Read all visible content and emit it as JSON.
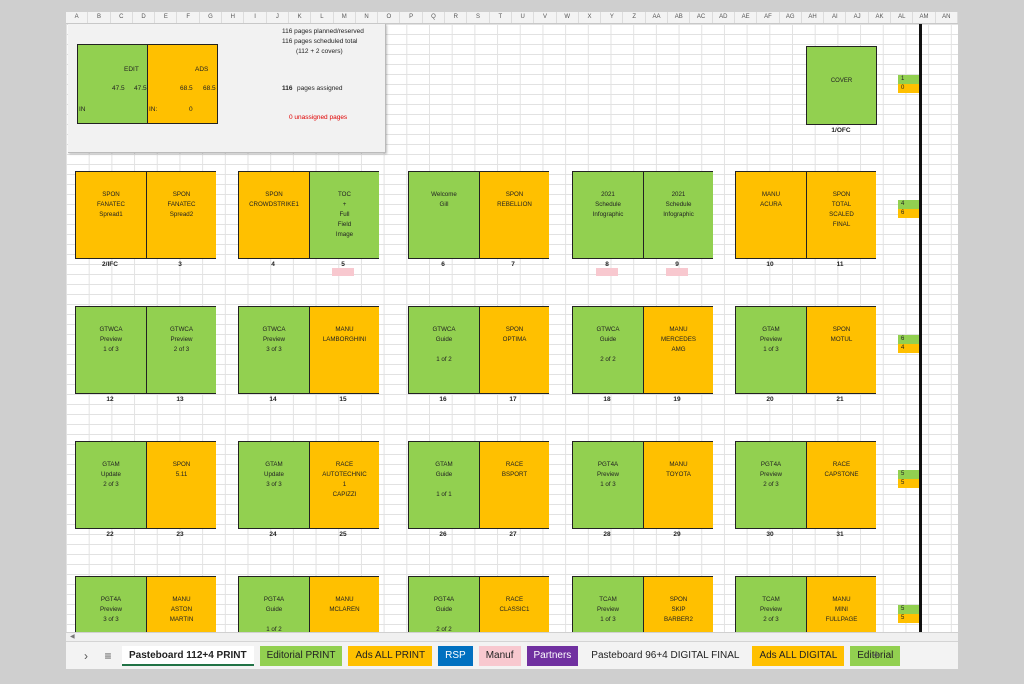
{
  "colors": {
    "editorial": "#92d050",
    "ads": "#ffc000",
    "pink": "#f8c8cf",
    "rsp": "#0070c0",
    "partners": "#7030a0"
  },
  "columns": [
    "A",
    "B",
    "C",
    "D",
    "E",
    "F",
    "G",
    "H",
    "I",
    "J",
    "K",
    "L",
    "M",
    "N",
    "O",
    "P",
    "Q",
    "R",
    "S",
    "T",
    "U",
    "V",
    "W",
    "X",
    "Y",
    "Z",
    "AA",
    "AB",
    "AC",
    "AD",
    "AE",
    "AF",
    "AG",
    "AH",
    "AI",
    "AJ",
    "AK",
    "AL",
    "AM",
    "AN"
  ],
  "summary": {
    "edit_label": "EDIT",
    "ads_label": "ADS",
    "edit_a": "47.5",
    "edit_b": "47.5",
    "ads_a": "68.5",
    "ads_b": "68.5",
    "in_label": "IN",
    "in2_label": "IN:",
    "in2_value": "0",
    "line1": "116 pages planned/reserved",
    "line2": "116 pages scheduled total",
    "line3": "(112 + 2 covers)",
    "assigned_num": "116",
    "assigned_label": "pages assigned",
    "unassigned": "0 unassigned pages"
  },
  "cover": {
    "label": "COVER",
    "page": "1/OFC"
  },
  "rows": [
    {
      "spreads": [
        {
          "left": {
            "text": "SPON\nFANATEC\nSpread1",
            "color": "orange",
            "page": "2/IFC"
          },
          "right": {
            "text": "SPON\nFANATEC\nSpread2",
            "color": "orange",
            "page": "3"
          }
        },
        {
          "left": {
            "text": "SPON\nCROWDSTRIKE1",
            "color": "orange",
            "page": "4"
          },
          "right": {
            "text": "TOC\n+\nFull\nField\nImage",
            "color": "green",
            "page": "5",
            "pink": true
          }
        },
        {
          "left": {
            "text": "Welcome\nGill",
            "color": "green",
            "page": "6"
          },
          "right": {
            "text": "SPON\nREBELLION",
            "color": "orange",
            "page": "7"
          }
        },
        {
          "left": {
            "text": "2021\nSchedule\nInfographic",
            "color": "green",
            "page": "8",
            "pink": true
          },
          "right": {
            "text": "2021\nSchedule\nInfographic",
            "color": "green",
            "page": "9",
            "pink": true
          }
        },
        {
          "left": {
            "text": "MANU\nACURA",
            "color": "orange",
            "page": "10"
          },
          "right": {
            "text": "SPON\nTOTAL\nSCALED\nFINAL",
            "color": "orange",
            "page": "11"
          }
        }
      ],
      "counts": [
        "4",
        "6"
      ]
    },
    {
      "spreads": [
        {
          "left": {
            "text": "GTWCA\nPreview\n1 of 3",
            "color": "green",
            "page": "12"
          },
          "right": {
            "text": "GTWCA\nPreview\n2 of 3",
            "color": "green",
            "page": "13"
          }
        },
        {
          "left": {
            "text": "GTWCA\nPreview\n3 of 3",
            "color": "green",
            "page": "14"
          },
          "right": {
            "text": "MANU\nLAMBORGHINI",
            "color": "orange",
            "page": "15"
          }
        },
        {
          "left": {
            "text": "GTWCA\nGuide\n\n1 of 2",
            "color": "green",
            "page": "16"
          },
          "right": {
            "text": "SPON\nOPTIMA",
            "color": "orange",
            "page": "17"
          }
        },
        {
          "left": {
            "text": "GTWCA\nGuide\n\n2 of 2",
            "color": "green",
            "page": "18"
          },
          "right": {
            "text": "MANU\nMERCEDES\nAMG",
            "color": "orange",
            "page": "19"
          }
        },
        {
          "left": {
            "text": "GTAM\nPreview\n1 of 3",
            "color": "green",
            "page": "20"
          },
          "right": {
            "text": "SPON\nMOTUL",
            "color": "orange",
            "page": "21"
          }
        }
      ],
      "counts": [
        "6",
        "4"
      ]
    },
    {
      "spreads": [
        {
          "left": {
            "text": "GTAM\nUpdate\n2 of 3",
            "color": "green",
            "page": "22"
          },
          "right": {
            "text": "SPON\n5.11",
            "color": "orange",
            "page": "23"
          }
        },
        {
          "left": {
            "text": "GTAM\nUpdate\n3 of 3",
            "color": "green",
            "page": "24"
          },
          "right": {
            "text": "RACE\nAUTOTECHNIC\n1\nCAPIZZI",
            "color": "orange",
            "page": "25"
          }
        },
        {
          "left": {
            "text": "GTAM\nGuide\n\n1 of 1",
            "color": "green",
            "page": "26"
          },
          "right": {
            "text": "RACE\nBSPORT",
            "color": "orange",
            "page": "27"
          }
        },
        {
          "left": {
            "text": "PGT4A\nPreview\n1 of 3",
            "color": "green",
            "page": "28"
          },
          "right": {
            "text": "MANU\nTOYOTA",
            "color": "orange",
            "page": "29"
          }
        },
        {
          "left": {
            "text": "PGT4A\nPreview\n2 of 3",
            "color": "green",
            "page": "30"
          },
          "right": {
            "text": "RACE\nCAPSTONE",
            "color": "orange",
            "page": "31"
          }
        }
      ],
      "counts": [
        "5",
        "5"
      ]
    },
    {
      "spreads": [
        {
          "left": {
            "text": "PGT4A\nPreview\n3 of 3",
            "color": "green",
            "page": ""
          },
          "right": {
            "text": "MANU\nASTON\nMARTIN",
            "color": "orange",
            "page": ""
          }
        },
        {
          "left": {
            "text": "PGT4A\nGuide\n\n1 of 2",
            "color": "green",
            "page": ""
          },
          "right": {
            "text": "MANU\nMCLAREN",
            "color": "orange",
            "page": ""
          }
        },
        {
          "left": {
            "text": "PGT4A\nGuide\n\n2 of 2",
            "color": "green",
            "page": ""
          },
          "right": {
            "text": "RACE\nCLASSIC1",
            "color": "orange",
            "page": ""
          }
        },
        {
          "left": {
            "text": "TCAM\nPreview\n1 of 3",
            "color": "green",
            "page": ""
          },
          "right": {
            "text": "SPON\nSKIP\nBARBER2",
            "color": "orange",
            "page": ""
          }
        },
        {
          "left": {
            "text": "TCAM\nPreview\n2 of 3",
            "color": "green",
            "page": ""
          },
          "right": {
            "text": "MANU\nMINI\nFULLPAGE",
            "color": "orange",
            "page": ""
          }
        }
      ],
      "counts": [
        "5",
        "5"
      ]
    }
  ],
  "cover_counts": [
    "1",
    "0"
  ],
  "tabs": [
    {
      "label": "Pasteboard 112+4 PRINT",
      "bg": "#ffffff",
      "color": "#222",
      "active": true
    },
    {
      "label": "Editorial PRINT",
      "bg": "#92d050",
      "color": "#222"
    },
    {
      "label": "Ads ALL PRINT",
      "bg": "#ffc000",
      "color": "#222"
    },
    {
      "label": "RSP",
      "bg": "#0070c0",
      "color": "#ffffff"
    },
    {
      "label": "Manuf",
      "bg": "#f8c8cf",
      "color": "#222"
    },
    {
      "label": "Partners",
      "bg": "#7030a0",
      "color": "#ffffff"
    },
    {
      "label": "Pasteboard 96+4 DIGITAL FINAL",
      "bg": "transparent",
      "color": "#222"
    },
    {
      "label": "Ads ALL DIGITAL",
      "bg": "#ffc000",
      "color": "#222"
    },
    {
      "label": "Editorial",
      "bg": "#92d050",
      "color": "#222"
    }
  ],
  "icons": {
    "nav": "chevron-right-icon",
    "menu": "hamburger-icon",
    "add": "plus-icon",
    "scroll_left": "triangle-left-icon"
  }
}
